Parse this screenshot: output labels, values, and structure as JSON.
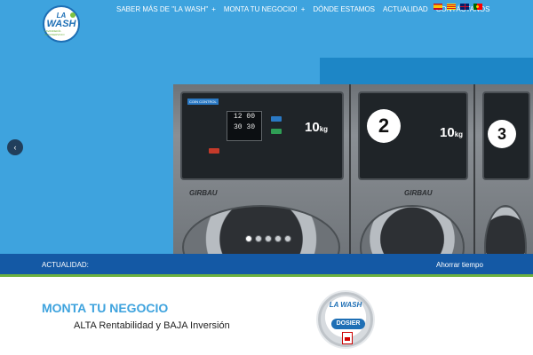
{
  "header": {
    "logo": {
      "line1": "LA",
      "line2": "WASH",
      "tagline": "LAVANDERÍA AUTOSERVICIO"
    },
    "nav": [
      {
        "label": "SABER MÁS DE \"LA WASH\"",
        "has_submenu": true
      },
      {
        "label": "MONTA TU NEGOCIO!",
        "has_submenu": true
      },
      {
        "label": "DÓNDE ESTAMOS",
        "has_submenu": false
      },
      {
        "label": "ACTUALIDAD",
        "has_submenu": false
      },
      {
        "label": "CONTÁCTANOS",
        "has_submenu": false
      }
    ],
    "submenu_icon": "+",
    "languages": [
      "es",
      "ca",
      "en",
      "pt"
    ]
  },
  "slider": {
    "prev_icon": "‹",
    "machines": [
      {
        "number": "",
        "kg": "10",
        "unit": "kg",
        "brand": "GIRBAU",
        "display_top": "12 00",
        "display_bottom": "30 30",
        "panel_label": "COIN CONTROL"
      },
      {
        "number": "2",
        "kg": "10",
        "unit": "kg",
        "brand": "GIRBAU"
      },
      {
        "number": "3",
        "kg": "",
        "unit": "",
        "brand": ""
      }
    ],
    "slides_total": 5,
    "active_slide": 1
  },
  "ticker": {
    "label": "ACTUALIDAD:",
    "text": "Ahorrar tiempo"
  },
  "content": {
    "title": "MONTA TU NEGOCIO",
    "subtitle": "ALTA Rentabilidad y BAJA Inversión",
    "dosier": {
      "brand": "LA WASH",
      "label": "DOSIER",
      "icon": "pdf-icon"
    }
  },
  "colors": {
    "header_bg": "#3ea3de",
    "ticker_bg": "#1459a5",
    "accent_green": "#6db13f",
    "title_blue": "#3ea3de"
  }
}
